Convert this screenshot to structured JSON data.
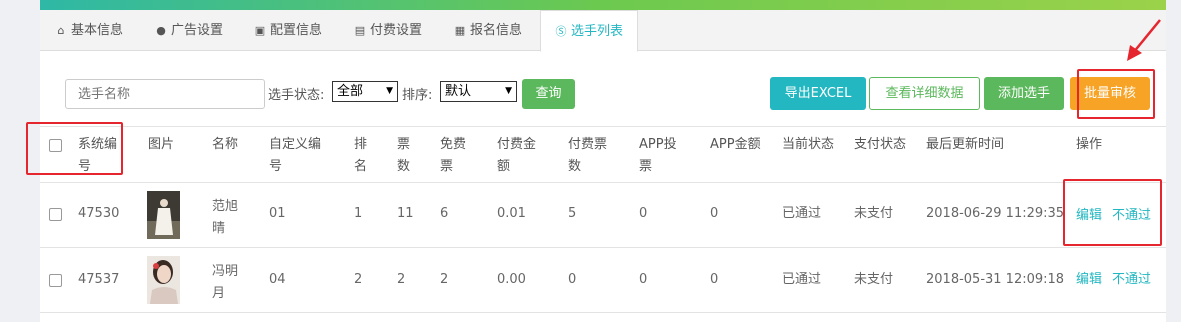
{
  "tabs": [
    {
      "label": "基本信息",
      "icon": "home-icon"
    },
    {
      "label": "广告设置",
      "icon": "circle-arrow-icon"
    },
    {
      "label": "配置信息",
      "icon": "save-icon"
    },
    {
      "label": "付费设置",
      "icon": "document-icon"
    },
    {
      "label": "报名信息",
      "icon": "form-icon"
    },
    {
      "label": "选手列表",
      "icon": "skype-icon"
    }
  ],
  "filters": {
    "name_placeholder": "选手名称",
    "status_label": "选手状态:",
    "status_value": "全部",
    "sort_label": "排序:",
    "sort_value": "默认",
    "query_button": "查询"
  },
  "actions": {
    "export": "导出EXCEL",
    "details": "查看详细数据",
    "add": "添加选手",
    "batch_review": "批量审核"
  },
  "columns": [
    "系统编号",
    "图片",
    "名称",
    "自定义编号",
    "排名",
    "票数",
    "免费票",
    "付费金额",
    "付费票数",
    "APP投票",
    "APP金额",
    "当前状态",
    "支付状态",
    "最后更新时间",
    "操作"
  ],
  "rows": [
    {
      "id": "47530",
      "name": "范旭晴",
      "custom_no": "01",
      "rank": "1",
      "votes": "11",
      "free": "6",
      "paid_amount": "0.01",
      "paid_votes": "5",
      "app_votes": "0",
      "app_amount": "0",
      "status": "已通过",
      "pay_status": "未支付",
      "updated": "2018-06-29 11:29:35",
      "edit": "编辑",
      "reject": "不通过"
    },
    {
      "id": "47537",
      "name": "冯明月",
      "custom_no": "04",
      "rank": "2",
      "votes": "2",
      "free": "2",
      "paid_amount": "0.00",
      "paid_votes": "0",
      "app_votes": "0",
      "app_amount": "0",
      "status": "已通过",
      "pay_status": "未支付",
      "updated": "2018-05-31 12:09:18",
      "edit": "编辑",
      "reject": "不通过"
    }
  ],
  "colors": {
    "accent": "#23b7c1",
    "query": "#5cb85c",
    "orange": "#f7a326",
    "annotation": "#e6262e"
  }
}
